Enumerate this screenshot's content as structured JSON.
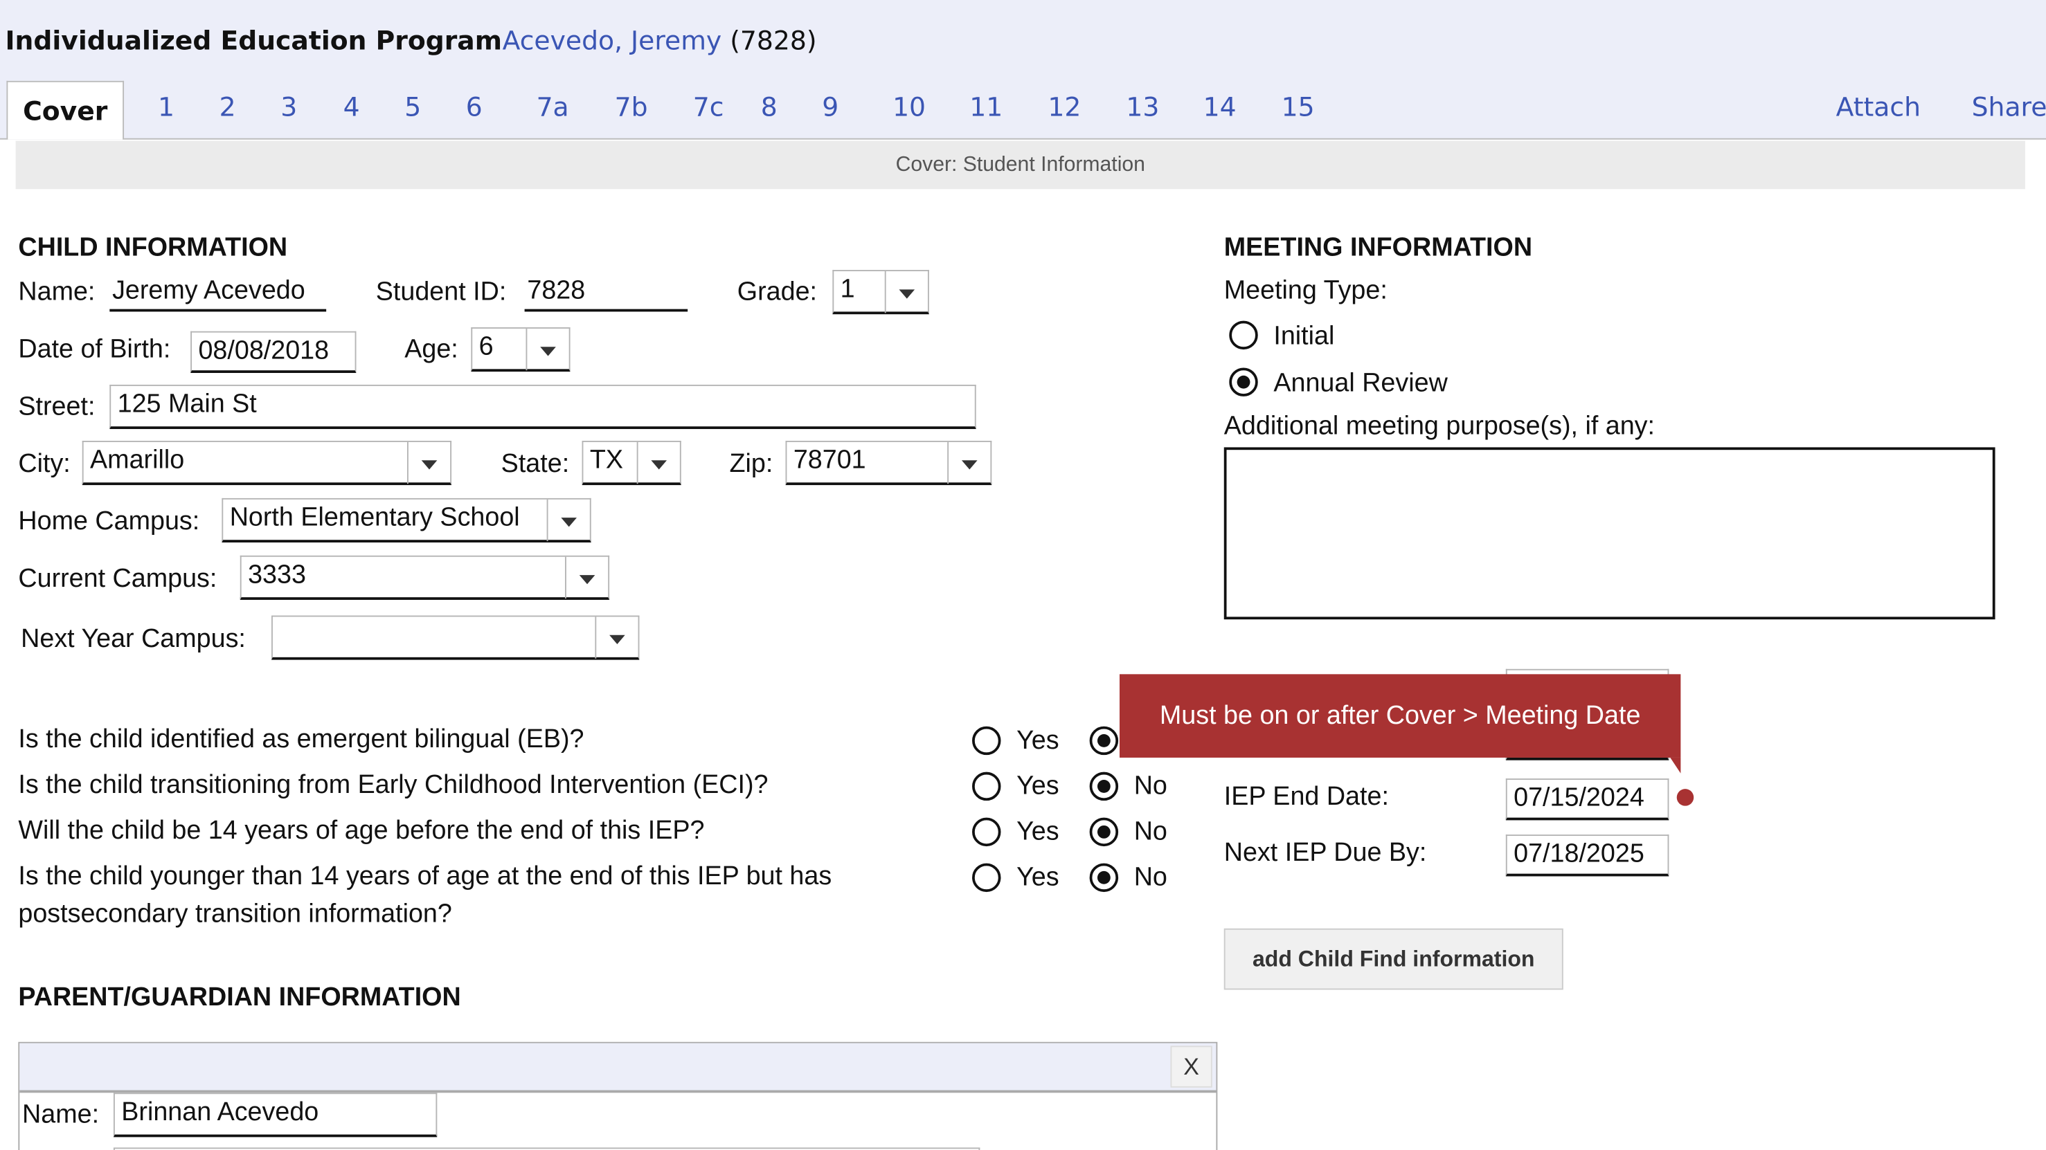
{
  "header": {
    "title": "Individualized Education Program",
    "student_name": "Acevedo, Jeremy",
    "student_id": "(7828)"
  },
  "tabs": [
    "Cover",
    "1",
    "2",
    "3",
    "4",
    "5",
    "6",
    "7a",
    "7b",
    "7c",
    "8",
    "9",
    "10",
    "11",
    "12",
    "13",
    "14",
    "15"
  ],
  "right_tabs": {
    "attach": "Attach",
    "share": "Share"
  },
  "section_title": "Cover: Student Information",
  "child": {
    "heading": "CHILD INFORMATION",
    "name_label": "Name:",
    "name": "Jeremy Acevedo",
    "sid_label": "Student ID:",
    "sid": "7828",
    "grade_label": "Grade:",
    "grade": "1",
    "dob_label": "Date of Birth:",
    "dob": "08/08/2018",
    "age_label": "Age:",
    "age": "6",
    "street_label": "Street:",
    "street": "125 Main St",
    "city_label": "City:",
    "city": "Amarillo",
    "state_label": "State:",
    "state": "TX",
    "zip_label": "Zip:",
    "zip": "78701",
    "home_label": "Home Campus:",
    "home": "North Elementary School",
    "current_label": "Current Campus:",
    "current": "3333",
    "next_label": "Next Year Campus:",
    "next": ""
  },
  "questions": [
    {
      "text": "Is the child identified as emergent bilingual (EB)?",
      "answer": "No"
    },
    {
      "text": "Is the child transitioning from Early Childhood Intervention (ECI)?",
      "answer": "No"
    },
    {
      "text": "Will the child be 14 years of age before the end of this IEP?",
      "answer": "No"
    },
    {
      "text": "Is the child younger than 14 years of age at the end of this IEP but has",
      "text2": "postsecondary transition information?",
      "answer": "No"
    }
  ],
  "yes_label": "Yes",
  "no_label": "No",
  "meeting": {
    "heading": "MEETING INFORMATION",
    "type_label": "Meeting Type:",
    "options": [
      "Initial",
      "Annual Review"
    ],
    "selected": "Annual Review",
    "purpose_label": "Additional meeting purpose(s), if any:",
    "purpose": "",
    "tooltip": "Must be on or after Cover > Meeting Date",
    "end_label": "IEP End Date:",
    "end": "07/15/2024",
    "due_label": "Next IEP Due By:",
    "due": "07/18/2025",
    "button": "add Child Find information"
  },
  "parent": {
    "heading": "PARENT/GUARDIAN INFORMATION",
    "close": "X",
    "name_label": "Name:",
    "name": "Brinnan Acevedo"
  },
  "colors": {
    "accent": "#3a55b4",
    "error": "#a83232",
    "band": "#eceef9"
  }
}
